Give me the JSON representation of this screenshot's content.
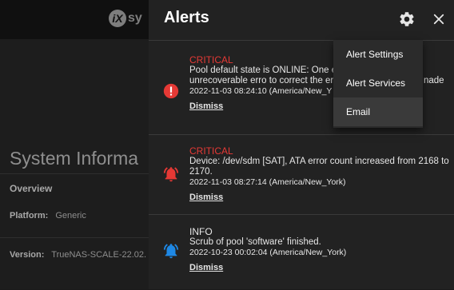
{
  "app": {
    "logo_mark": "iX",
    "logo_text": "sy",
    "section_title": "System Informa",
    "overview_label": "Overview",
    "platform_key": "Platform:",
    "platform_value": "Generic",
    "version_key": "Version:",
    "version_value": "TrueNAS-SCALE-22.02."
  },
  "alerts_panel": {
    "title": "Alerts",
    "settings_icon": "gear-icon",
    "close_icon": "close-icon",
    "alerts": [
      {
        "level": "CRITICAL",
        "icon": "error-circle-icon",
        "message": "Pool default state is ONLINE: One experienced an unrecoverable erro to correct the error. Applications a",
        "message_overflow": "nade",
        "timestamp": "2022-11-03 08:24:10 (America/New_Y",
        "dismiss": "Dismiss",
        "color": "#e53935"
      },
      {
        "level": "CRITICAL",
        "icon": "bell-alert-icon",
        "message": "Device: /dev/sdm [SAT], ATA error count increased from 2168 to 2170.",
        "timestamp": "2022-11-03 08:27:14 (America/New_York)",
        "dismiss": "Dismiss",
        "color": "#e53935"
      },
      {
        "level": "INFO",
        "icon": "bell-alert-icon",
        "message": "Scrub of pool 'software' finished.",
        "timestamp": "2022-10-23 00:02:04 (America/New_York)",
        "dismiss": "Dismiss",
        "color": "#1e88e5"
      }
    ]
  },
  "settings_menu": {
    "items": [
      "Alert Settings",
      "Alert Services",
      "Email"
    ]
  }
}
